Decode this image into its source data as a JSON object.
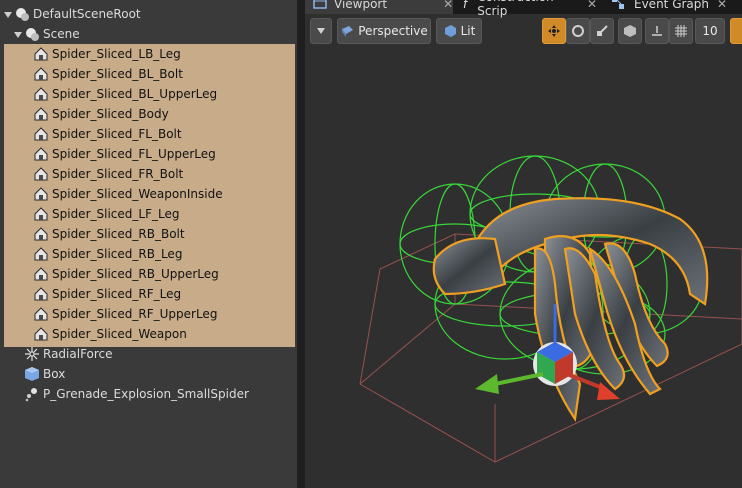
{
  "tree": {
    "root": "DefaultSceneRoot",
    "scene": "Scene",
    "selected_items": [
      "Spider_Sliced_LB_Leg",
      "Spider_Sliced_BL_Bolt",
      "Spider_Sliced_BL_UpperLeg",
      "Spider_Sliced_Body",
      "Spider_Sliced_FL_Bolt",
      "Spider_Sliced_FL_UpperLeg",
      "Spider_Sliced_FR_Bolt",
      "Spider_Sliced_WeaponInside",
      "Spider_Sliced_LF_Leg",
      "Spider_Sliced_RB_Bolt",
      "Spider_Sliced_RB_Leg",
      "Spider_Sliced_RB_UpperLeg",
      "Spider_Sliced_RF_Leg",
      "Spider_Sliced_RF_UpperLeg",
      "Spider_Sliced_Weapon"
    ],
    "other_items": [
      {
        "label": "RadialForce",
        "icon": "radial-force-icon"
      },
      {
        "label": "Box",
        "icon": "box-icon"
      },
      {
        "label": "P_Grenade_Explosion_SmallSpider",
        "icon": "particle-icon"
      }
    ]
  },
  "tabs": [
    {
      "label": "Viewport",
      "icon": "viewport-icon",
      "active": true
    },
    {
      "label": "Construction Scrip",
      "icon": "function-icon",
      "active": false
    },
    {
      "label": "Event Graph",
      "icon": "graph-icon",
      "active": false
    }
  ],
  "toolbar": {
    "perspective": "Perspective",
    "lit": "Lit",
    "grid_snap_value": "10"
  },
  "colors": {
    "selection": "#c8ab88",
    "panel": "#3a3a3a",
    "viewport": "#2f2f2f",
    "accent_orange": "#d08a28",
    "collision_green": "#39d739"
  }
}
